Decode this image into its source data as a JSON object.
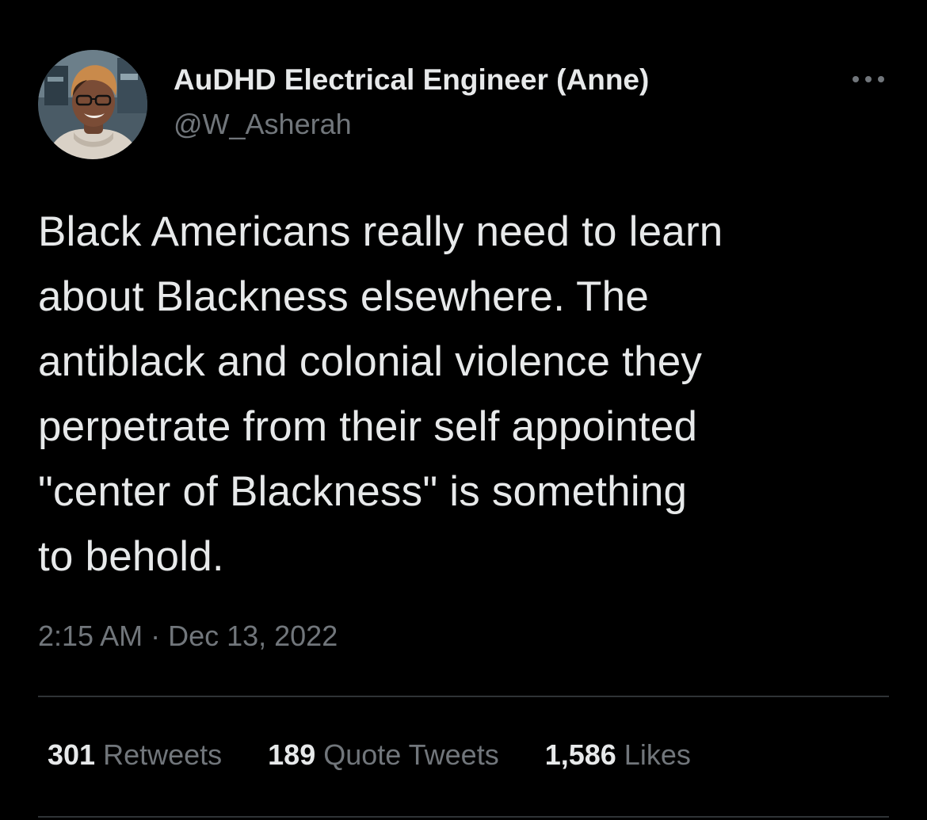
{
  "author": {
    "display_name": "AuDHD Electrical Engineer (Anne)",
    "handle": "@W_Asherah",
    "avatar_icon": "profile-photo"
  },
  "more_icon": "more-horizontal-icon",
  "tweet": {
    "text": "Black Americans really need to learn\nabout Blackness elsewhere. The\nantiblack and colonial violence they\nperpetrate from their self appointed\n\"center of Blackness\" is something\nto behold.",
    "timestamp": "2:15 AM · Dec 13, 2022"
  },
  "stats": {
    "retweets": {
      "count": "301",
      "label": "Retweets"
    },
    "quote_tweets": {
      "count": "189",
      "label": "Quote Tweets"
    },
    "likes": {
      "count": "1,586",
      "label": "Likes"
    }
  },
  "colors": {
    "background": "#000000",
    "primary_text": "#e7e9ea",
    "secondary_text": "#71767b",
    "divider": "#2f3336"
  }
}
